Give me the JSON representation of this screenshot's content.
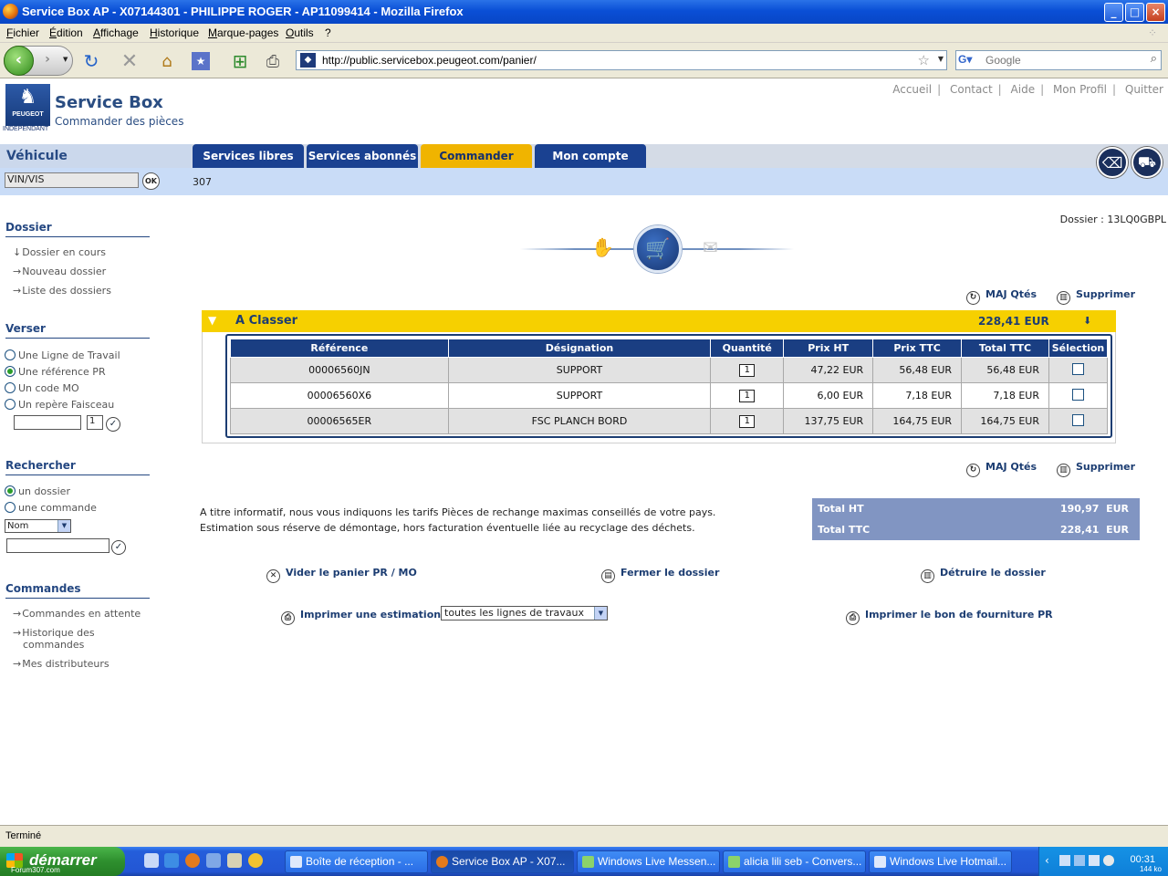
{
  "window": {
    "title": "Service Box AP - X07144301  - PHILIPPE ROGER - AP11099414 - Mozilla Firefox",
    "min": "_",
    "max": "□",
    "close": "×"
  },
  "menu": [
    "Fichier",
    "Édition",
    "Affichage",
    "Historique",
    "Marque-pages",
    "Outils",
    "?"
  ],
  "browser": {
    "url": "http://public.servicebox.peugeot.com/panier/",
    "search_placeholder": "Google"
  },
  "app": {
    "brand": "PEUGEOT",
    "brand_sub": "INDEPENDANT",
    "title": "Service Box",
    "subtitle": "Commander des pièces",
    "toplinks": [
      "Accueil",
      "Contact",
      "Aide",
      "Mon Profil",
      "Quitter"
    ]
  },
  "vehicle": {
    "label": "Véhicule",
    "vin_value": "VIN/VIS",
    "ok": "OK",
    "model": "307"
  },
  "tabs": [
    {
      "label": "Services libres"
    },
    {
      "label": "Services abonnés"
    },
    {
      "label": "Commander"
    },
    {
      "label": "Mon compte"
    }
  ],
  "sidebar": {
    "dossier_title": "Dossier",
    "dossier_links": [
      "Dossier en cours",
      "Nouveau dossier",
      "Liste des dossiers"
    ],
    "verser_title": "Verser",
    "verser_options": [
      "Une Ligne de Travail",
      "Une référence PR",
      "Un code MO",
      "Un repère Faisceau"
    ],
    "verser_qty": "1",
    "rechercher_title": "Rechercher",
    "rechercher_options": [
      "un dossier",
      "une commande"
    ],
    "rechercher_select": "Nom",
    "commandes_title": "Commandes",
    "commandes_links": [
      "Commandes en attente",
      "Historique des commandes",
      "Mes distributeurs"
    ]
  },
  "dossier": {
    "label": "Dossier",
    "id": "13LQ0GBPL"
  },
  "actions": {
    "maj": "MAJ Qtés",
    "supprimer": "Supprimer",
    "vider": "Vider le panier PR / MO",
    "fermer": "Fermer le dossier",
    "detruire": "Détruire le dossier",
    "imprimer_estimation": "Imprimer une estimation",
    "imprimer_bon": "Imprimer le bon de fourniture PR",
    "print_select": "toutes les lignes de travaux"
  },
  "basket": {
    "title": "A Classer",
    "amount": "228,41",
    "currency": "EUR",
    "columns": [
      "Référence",
      "Désignation",
      "Quantité",
      "Prix HT",
      "Prix TTC",
      "Total TTC",
      "Sélection"
    ],
    "rows": [
      {
        "ref": "00006560JN",
        "designation": "SUPPORT",
        "qty": "1",
        "prix_ht": "47,22 EUR",
        "prix_ttc": "56,48 EUR",
        "total_ttc": "56,48 EUR"
      },
      {
        "ref": "00006560X6",
        "designation": "SUPPORT",
        "qty": "1",
        "prix_ht": "6,00 EUR",
        "prix_ttc": "7,18 EUR",
        "total_ttc": "7,18 EUR"
      },
      {
        "ref": "00006565ER",
        "designation": "FSC PLANCH BORD",
        "qty": "1",
        "prix_ht": "137,75 EUR",
        "prix_ttc": "164,75 EUR",
        "total_ttc": "164,75 EUR"
      }
    ]
  },
  "info": {
    "line1": "A titre informatif, nous vous indiquons les tarifs Pièces de rechange maximas conseillés de votre pays.",
    "line2": "Estimation sous réserve de démontage, hors facturation éventuelle liée au recyclage des déchets."
  },
  "totals": {
    "ht_label": "Total HT",
    "ht_value": "190,97  EUR",
    "ttc_label": "Total TTC",
    "ttc_value": "228,41  EUR"
  },
  "status": "Terminé",
  "taskbar": {
    "start": "démarrer",
    "forum": "Forum307.com",
    "tasks": [
      "Boîte de réception - ...",
      "Service Box AP - X07...",
      "Windows Live Messen...",
      "alicia lili seb - Convers...",
      "Windows Live Hotmail..."
    ],
    "clock": "00:31",
    "size": "144 ko"
  }
}
